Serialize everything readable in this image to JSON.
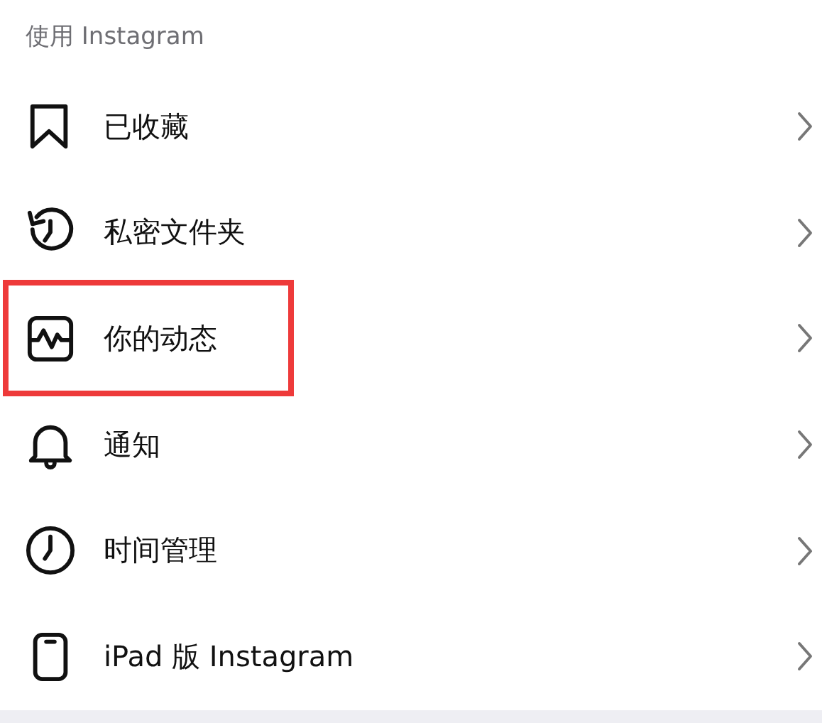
{
  "section": {
    "title": "使用 Instagram"
  },
  "items": [
    {
      "kind": "bookmark",
      "label": "已收藏",
      "highlighted": false
    },
    {
      "kind": "history",
      "label": "私密文件夹",
      "highlighted": false
    },
    {
      "kind": "activity",
      "label": "你的动态",
      "highlighted": true
    },
    {
      "kind": "bell",
      "label": "通知",
      "highlighted": false
    },
    {
      "kind": "clock",
      "label": "时间管理",
      "highlighted": false
    },
    {
      "kind": "tablet",
      "label": "iPad 版 Instagram",
      "highlighted": false
    }
  ]
}
